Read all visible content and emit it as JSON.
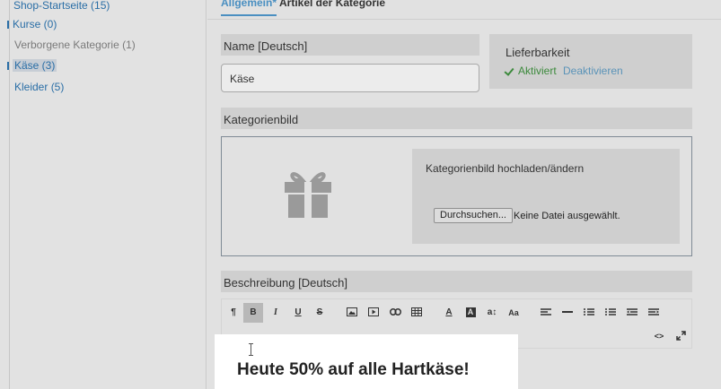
{
  "sidebar": {
    "items": [
      {
        "label": "Shop-Startseite (15)"
      },
      {
        "label": "Kurse (0)"
      },
      {
        "label": "Verborgene Kategorie (1)"
      },
      {
        "label": "Käse (3)"
      },
      {
        "label": "Kleider (5)"
      }
    ]
  },
  "tabs": [
    {
      "label": "Allgemein*"
    },
    {
      "label": "Artikel der Kategorie"
    }
  ],
  "name_section": {
    "title": "Name [Deutsch]",
    "value": "Käse"
  },
  "availability": {
    "title": "Lieferbarkeit",
    "active_label": "Aktiviert",
    "deactivate_label": "Deaktivieren",
    "active_color": "#3c8a3c",
    "link_color": "#5a93b8"
  },
  "image_section": {
    "title": "Kategorienbild",
    "upload_title": "Kategorienbild hochladen/ändern",
    "browse_label": "Durchsuchen...",
    "file_status": "Keine Datei ausgewählt.",
    "placeholder_icon": "gift-icon"
  },
  "description_section": {
    "title": "Beschreibung [Deutsch]"
  },
  "toolbar": {
    "paragraph": "¶",
    "bold": "B",
    "italic": "I",
    "underline": "U",
    "strike": "S",
    "color_a": "A",
    "bg_a": "A",
    "size": "a↕",
    "case": "Aa",
    "source": "<>"
  },
  "editor": {
    "heading": "Heute 50% auf alle Hartkäse!"
  },
  "colors": {
    "accent": "#4a8fc1",
    "link": "#2a6ea6",
    "panel": "#cfcfcf"
  }
}
